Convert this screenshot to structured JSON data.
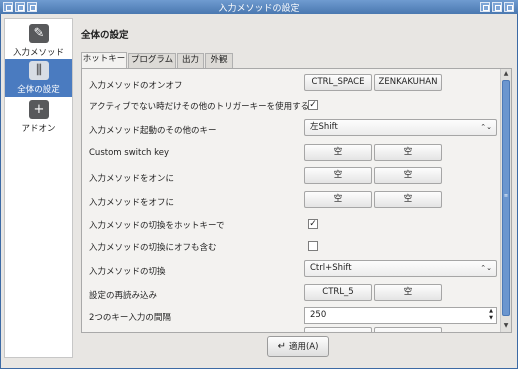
{
  "window": {
    "title": "入力メソッドの設定"
  },
  "sidebar": {
    "items": [
      {
        "label": "入力メソッド",
        "icon": "pencil-icon"
      },
      {
        "label": "全体の設定",
        "icon": "sliders-icon"
      },
      {
        "label": "アドオン",
        "icon": "plus-icon"
      }
    ],
    "selected": "全体の設定"
  },
  "main": {
    "title": "全体の設定",
    "tabs": [
      "ホットキー",
      "プログラム",
      "出力",
      "外観"
    ],
    "active_tab": "ホットキー"
  },
  "rows": {
    "r0": {
      "label": "入力メソッドのオンオフ",
      "key1": "CTRL_SPACE",
      "key2": "ZENKAKUHAN"
    },
    "r1": {
      "label": "アクティブでない時だけその他のトリガーキーを使用する",
      "checked": "✓"
    },
    "r2": {
      "label": "入力メソッド起動のその他のキー",
      "value": "左Shift"
    },
    "r3": {
      "label": "Custom switch key",
      "key1": "空",
      "key2": "空"
    },
    "r4": {
      "label": "入力メソッドをオンに",
      "key1": "空",
      "key2": "空"
    },
    "r5": {
      "label": "入力メソッドをオフに",
      "key1": "空",
      "key2": "空"
    },
    "r6": {
      "label": "入力メソッドの切換をホットキーで",
      "checked": "✓"
    },
    "r7": {
      "label": "入力メソッドの切換にオフも含む",
      "checked": ""
    },
    "r8": {
      "label": "入力メソッドの切換",
      "value": "Ctrl+Shift"
    },
    "r9": {
      "label": "設定の再読み込み",
      "key1": "CTRL_5",
      "key2": "空"
    },
    "r10": {
      "label": "2つのキー入力の間隔",
      "value": "250"
    }
  },
  "footer": {
    "apply_label": "適用(A)"
  }
}
